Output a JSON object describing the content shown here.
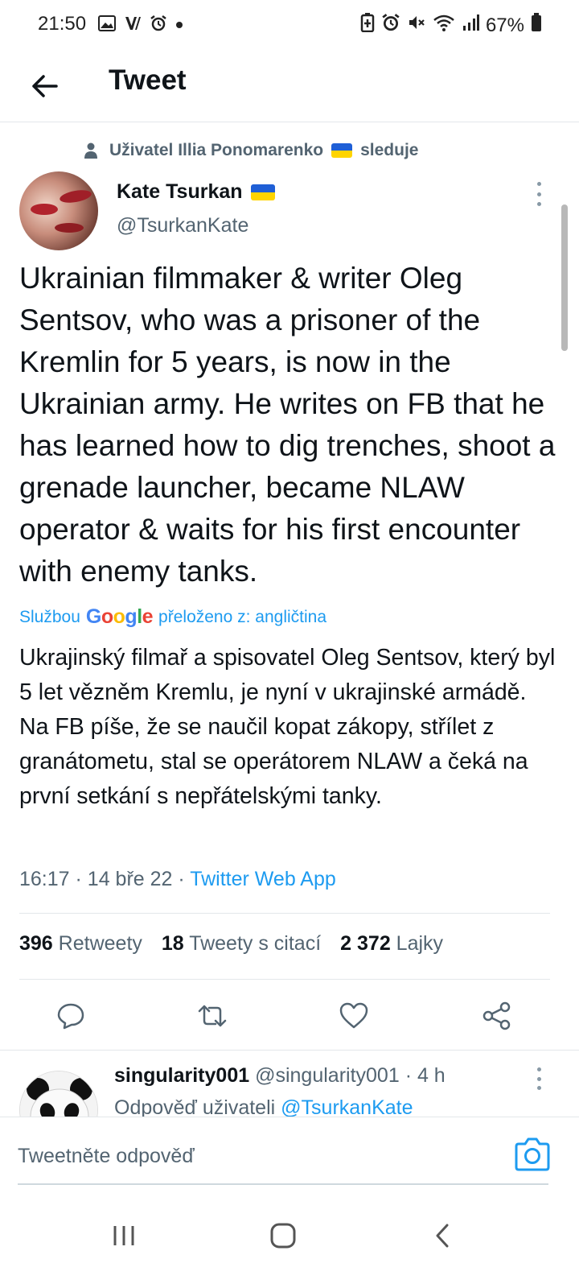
{
  "status_bar": {
    "time": "21:50",
    "battery": "67%",
    "left_icons": [
      "gallery-icon",
      "v-icon",
      "alarm-icon",
      "dot-icon"
    ],
    "right_icons": [
      "battery-saver-icon",
      "alarm-icon",
      "mute-icon",
      "wifi-icon",
      "signal-icon",
      "battery-icon"
    ]
  },
  "header": {
    "title": "Tweet"
  },
  "tweet": {
    "follow_note_prefix": "Uživatel Illia Ponomarenko",
    "follow_note_suffix": "sleduje",
    "author_name": "Kate Tsurkan",
    "author_handle": "@TsurkanKate",
    "text": "Ukrainian filmmaker & writer Oleg Sentsov, who was a prisoner of the Kremlin for 5 years, is now in the Ukrainian army. He writes on FB that he has learned how to dig trenches, shoot a grenade launcher, became NLAW operator & waits for his first encounter with enemy tanks.",
    "translation_prefix": "Službou",
    "translation_suffix": "přeloženo z: angličtina",
    "translated_text": "Ukrajinský filmař a spisovatel Oleg Sentsov, který byl 5 let vězněm Kremlu, je nyní v ukrajinské armádě. Na FB píše, že se naučil kopat zákopy, střílet z granátometu, stal se operátorem NLAW a čeká na první setkání s nepřátelskými tanky.",
    "time": "16:17",
    "date": "14 bře 22",
    "source": "Twitter Web App",
    "retweets_count": "396",
    "retweets_label": "Retweety",
    "quotes_count": "18",
    "quotes_label": "Tweety s citací",
    "likes_count": "2 372",
    "likes_label": "Lajky"
  },
  "reply": {
    "name": "singularity001",
    "handle": "@singularity001",
    "age": "· 4 h",
    "reply_to_prefix": "Odpověď uživateli",
    "reply_to_handle": "@TsurkanKate"
  },
  "compose": {
    "placeholder": "Tweetněte odpověď"
  },
  "colors": {
    "accent": "#1d9bf0",
    "text": "#0f1419",
    "secondary": "#536471"
  }
}
